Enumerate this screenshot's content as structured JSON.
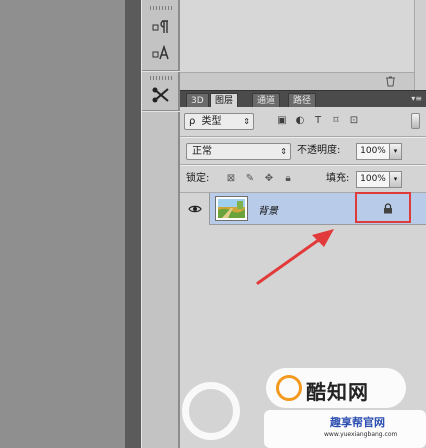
{
  "tabs": [
    "3D",
    "图层",
    "通道",
    "路径"
  ],
  "filter": {
    "label": "类型",
    "search_glyph": "ρ"
  },
  "blend": {
    "mode": "正常",
    "opacity_label": "不透明度:",
    "opacity": "100%"
  },
  "lock": {
    "label": "锁定:",
    "fill_label": "填充:",
    "fill": "100%"
  },
  "layer": {
    "name": "背景"
  },
  "watermark": {
    "main": "酷知网",
    "sub": "趣享帮官网",
    "url": "www.yuexiangbang.com"
  },
  "colors": {
    "selection": "#b8cbe8",
    "highlight": "#e03b3b",
    "tab_bar": "#4b4b4b"
  }
}
